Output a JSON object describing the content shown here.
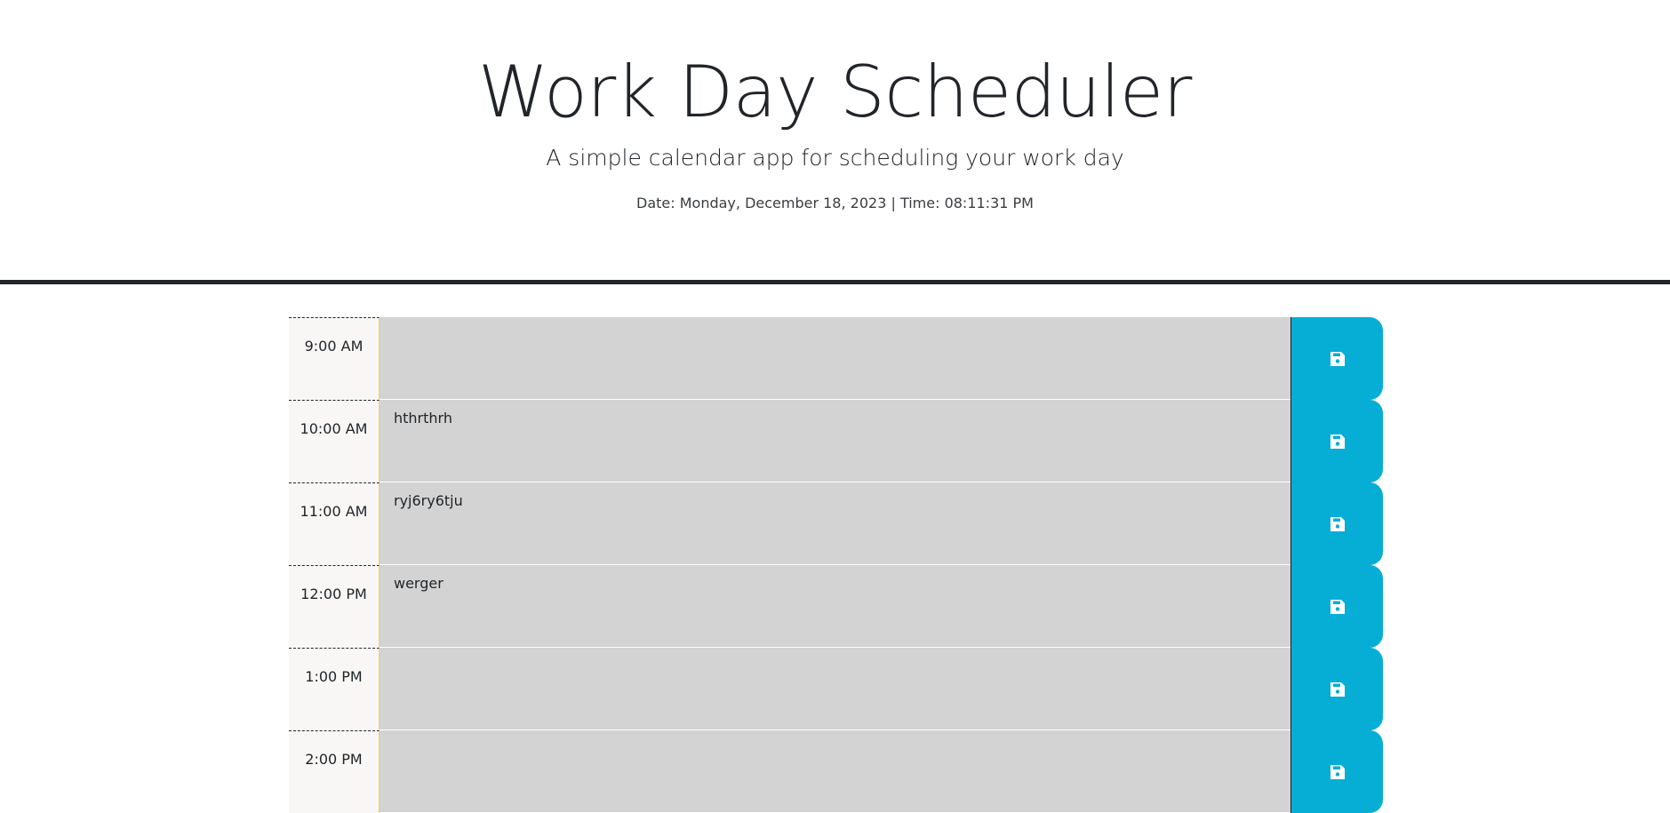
{
  "header": {
    "title": "Work Day Scheduler",
    "subtitle": "A simple calendar app for scheduling your work day",
    "datetime": "Date: Monday, December 18, 2023 | Time: 08:11:31 PM"
  },
  "timeblocks": [
    {
      "hour": "9:00 AM",
      "description": ""
    },
    {
      "hour": "10:00 AM",
      "description": "hthrthrh"
    },
    {
      "hour": "11:00 AM",
      "description": "ryj6ry6tju"
    },
    {
      "hour": "12:00 PM",
      "description": "werger"
    },
    {
      "hour": "1:00 PM",
      "description": ""
    },
    {
      "hour": "2:00 PM",
      "description": ""
    }
  ],
  "colors": {
    "save_button": "#06aed5",
    "past_block": "#d3d3d3",
    "hour_background": "#f9f7f6",
    "header_border": "#212529"
  },
  "icons": {
    "save": "floppy-disk-icon"
  }
}
